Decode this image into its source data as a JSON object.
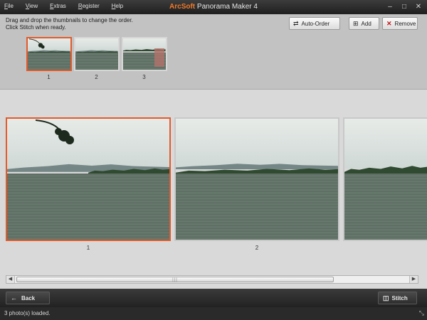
{
  "window": {
    "title_brand": "ArcSoft",
    "title_rest": " Panorama Maker 4",
    "menu": [
      "File",
      "View",
      "Extras",
      "Register",
      "Help"
    ],
    "controls": {
      "minimize": "–",
      "maximize": "□",
      "close": "✕"
    }
  },
  "toolbar": {
    "instruction_line1": "Drag and drop the thumbnails to change the order.",
    "instruction_line2": "Click Stitch when ready.",
    "auto_order_label": "Auto-Order",
    "add_label": "Add",
    "remove_label": "Remove"
  },
  "thumbnails": [
    {
      "label": "1",
      "selected": true
    },
    {
      "label": "2",
      "selected": false
    },
    {
      "label": "3",
      "selected": false
    }
  ],
  "photos": [
    {
      "label": "1",
      "selected": true
    },
    {
      "label": "2",
      "selected": false
    },
    {
      "label": "",
      "selected": false
    }
  ],
  "navigation": {
    "back_label": "Back",
    "stitch_label": "Stitch"
  },
  "status": {
    "text": "3 photo(s) loaded."
  },
  "colors": {
    "accent": "#e35a2a",
    "brand": "#f07a2a"
  }
}
